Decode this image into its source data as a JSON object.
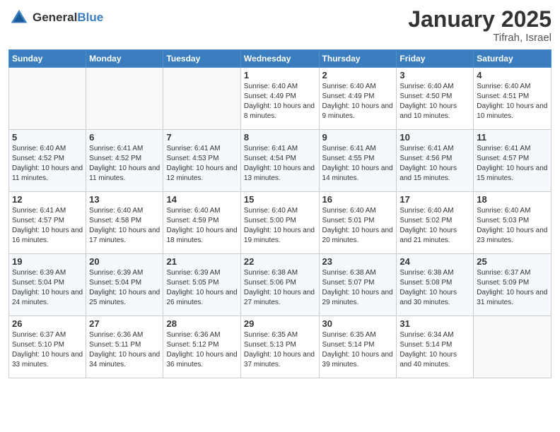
{
  "header": {
    "logo_general": "General",
    "logo_blue": "Blue",
    "month_title": "January 2025",
    "location": "Tifrah, Israel"
  },
  "days_of_week": [
    "Sunday",
    "Monday",
    "Tuesday",
    "Wednesday",
    "Thursday",
    "Friday",
    "Saturday"
  ],
  "weeks": [
    [
      {
        "day": "",
        "sunrise": "",
        "sunset": "",
        "daylight": ""
      },
      {
        "day": "",
        "sunrise": "",
        "sunset": "",
        "daylight": ""
      },
      {
        "day": "",
        "sunrise": "",
        "sunset": "",
        "daylight": ""
      },
      {
        "day": "1",
        "sunrise": "Sunrise: 6:40 AM",
        "sunset": "Sunset: 4:49 PM",
        "daylight": "Daylight: 10 hours and 8 minutes."
      },
      {
        "day": "2",
        "sunrise": "Sunrise: 6:40 AM",
        "sunset": "Sunset: 4:49 PM",
        "daylight": "Daylight: 10 hours and 9 minutes."
      },
      {
        "day": "3",
        "sunrise": "Sunrise: 6:40 AM",
        "sunset": "Sunset: 4:50 PM",
        "daylight": "Daylight: 10 hours and 10 minutes."
      },
      {
        "day": "4",
        "sunrise": "Sunrise: 6:40 AM",
        "sunset": "Sunset: 4:51 PM",
        "daylight": "Daylight: 10 hours and 10 minutes."
      }
    ],
    [
      {
        "day": "5",
        "sunrise": "Sunrise: 6:40 AM",
        "sunset": "Sunset: 4:52 PM",
        "daylight": "Daylight: 10 hours and 11 minutes."
      },
      {
        "day": "6",
        "sunrise": "Sunrise: 6:41 AM",
        "sunset": "Sunset: 4:52 PM",
        "daylight": "Daylight: 10 hours and 11 minutes."
      },
      {
        "day": "7",
        "sunrise": "Sunrise: 6:41 AM",
        "sunset": "Sunset: 4:53 PM",
        "daylight": "Daylight: 10 hours and 12 minutes."
      },
      {
        "day": "8",
        "sunrise": "Sunrise: 6:41 AM",
        "sunset": "Sunset: 4:54 PM",
        "daylight": "Daylight: 10 hours and 13 minutes."
      },
      {
        "day": "9",
        "sunrise": "Sunrise: 6:41 AM",
        "sunset": "Sunset: 4:55 PM",
        "daylight": "Daylight: 10 hours and 14 minutes."
      },
      {
        "day": "10",
        "sunrise": "Sunrise: 6:41 AM",
        "sunset": "Sunset: 4:56 PM",
        "daylight": "Daylight: 10 hours and 15 minutes."
      },
      {
        "day": "11",
        "sunrise": "Sunrise: 6:41 AM",
        "sunset": "Sunset: 4:57 PM",
        "daylight": "Daylight: 10 hours and 15 minutes."
      }
    ],
    [
      {
        "day": "12",
        "sunrise": "Sunrise: 6:41 AM",
        "sunset": "Sunset: 4:57 PM",
        "daylight": "Daylight: 10 hours and 16 minutes."
      },
      {
        "day": "13",
        "sunrise": "Sunrise: 6:40 AM",
        "sunset": "Sunset: 4:58 PM",
        "daylight": "Daylight: 10 hours and 17 minutes."
      },
      {
        "day": "14",
        "sunrise": "Sunrise: 6:40 AM",
        "sunset": "Sunset: 4:59 PM",
        "daylight": "Daylight: 10 hours and 18 minutes."
      },
      {
        "day": "15",
        "sunrise": "Sunrise: 6:40 AM",
        "sunset": "Sunset: 5:00 PM",
        "daylight": "Daylight: 10 hours and 19 minutes."
      },
      {
        "day": "16",
        "sunrise": "Sunrise: 6:40 AM",
        "sunset": "Sunset: 5:01 PM",
        "daylight": "Daylight: 10 hours and 20 minutes."
      },
      {
        "day": "17",
        "sunrise": "Sunrise: 6:40 AM",
        "sunset": "Sunset: 5:02 PM",
        "daylight": "Daylight: 10 hours and 21 minutes."
      },
      {
        "day": "18",
        "sunrise": "Sunrise: 6:40 AM",
        "sunset": "Sunset: 5:03 PM",
        "daylight": "Daylight: 10 hours and 23 minutes."
      }
    ],
    [
      {
        "day": "19",
        "sunrise": "Sunrise: 6:39 AM",
        "sunset": "Sunset: 5:04 PM",
        "daylight": "Daylight: 10 hours and 24 minutes."
      },
      {
        "day": "20",
        "sunrise": "Sunrise: 6:39 AM",
        "sunset": "Sunset: 5:04 PM",
        "daylight": "Daylight: 10 hours and 25 minutes."
      },
      {
        "day": "21",
        "sunrise": "Sunrise: 6:39 AM",
        "sunset": "Sunset: 5:05 PM",
        "daylight": "Daylight: 10 hours and 26 minutes."
      },
      {
        "day": "22",
        "sunrise": "Sunrise: 6:38 AM",
        "sunset": "Sunset: 5:06 PM",
        "daylight": "Daylight: 10 hours and 27 minutes."
      },
      {
        "day": "23",
        "sunrise": "Sunrise: 6:38 AM",
        "sunset": "Sunset: 5:07 PM",
        "daylight": "Daylight: 10 hours and 29 minutes."
      },
      {
        "day": "24",
        "sunrise": "Sunrise: 6:38 AM",
        "sunset": "Sunset: 5:08 PM",
        "daylight": "Daylight: 10 hours and 30 minutes."
      },
      {
        "day": "25",
        "sunrise": "Sunrise: 6:37 AM",
        "sunset": "Sunset: 5:09 PM",
        "daylight": "Daylight: 10 hours and 31 minutes."
      }
    ],
    [
      {
        "day": "26",
        "sunrise": "Sunrise: 6:37 AM",
        "sunset": "Sunset: 5:10 PM",
        "daylight": "Daylight: 10 hours and 33 minutes."
      },
      {
        "day": "27",
        "sunrise": "Sunrise: 6:36 AM",
        "sunset": "Sunset: 5:11 PM",
        "daylight": "Daylight: 10 hours and 34 minutes."
      },
      {
        "day": "28",
        "sunrise": "Sunrise: 6:36 AM",
        "sunset": "Sunset: 5:12 PM",
        "daylight": "Daylight: 10 hours and 36 minutes."
      },
      {
        "day": "29",
        "sunrise": "Sunrise: 6:35 AM",
        "sunset": "Sunset: 5:13 PM",
        "daylight": "Daylight: 10 hours and 37 minutes."
      },
      {
        "day": "30",
        "sunrise": "Sunrise: 6:35 AM",
        "sunset": "Sunset: 5:14 PM",
        "daylight": "Daylight: 10 hours and 39 minutes."
      },
      {
        "day": "31",
        "sunrise": "Sunrise: 6:34 AM",
        "sunset": "Sunset: 5:14 PM",
        "daylight": "Daylight: 10 hours and 40 minutes."
      },
      {
        "day": "",
        "sunrise": "",
        "sunset": "",
        "daylight": ""
      }
    ]
  ]
}
